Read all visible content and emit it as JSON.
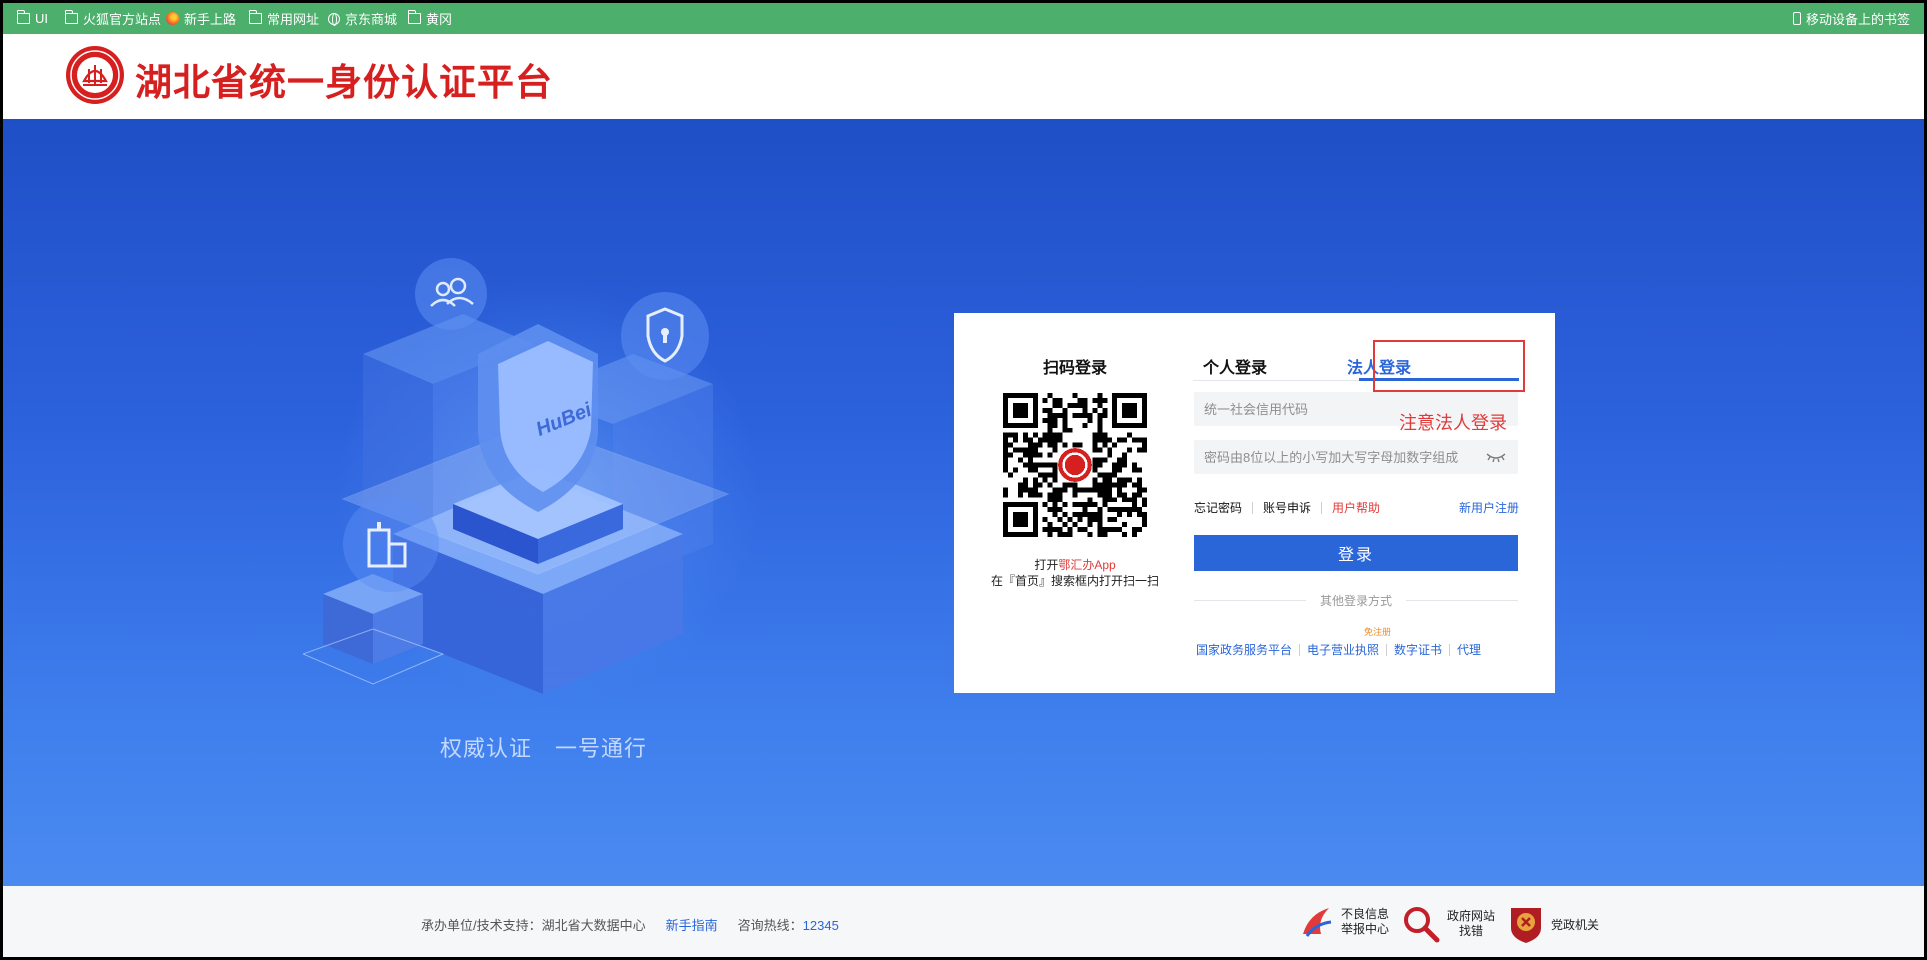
{
  "bookmarks": {
    "items": [
      {
        "label": "UI",
        "icon": "folder-icon"
      },
      {
        "label": "火狐官方站点",
        "icon": "folder-icon"
      },
      {
        "label": "新手上路",
        "icon": "firefox-icon"
      },
      {
        "label": "常用网址",
        "icon": "folder-icon"
      },
      {
        "label": "京东商城",
        "icon": "globe-icon"
      },
      {
        "label": "黄冈",
        "icon": "folder-icon"
      }
    ],
    "mobile": "移动设备上的书签"
  },
  "header": {
    "title": "湖北省统一身份认证平台"
  },
  "hero": {
    "slogan": "权威认证　一号通行"
  },
  "login": {
    "qr": {
      "title": "扫码登录",
      "hint_prefix": "打开",
      "hint_app": "鄂汇办App",
      "hint_line2": "在『首页』搜索框内打开扫一扫"
    },
    "tabs": {
      "personal": "个人登录",
      "legal": "法人登录"
    },
    "fields": {
      "credit_code_placeholder": "统一社会信用代码",
      "password_placeholder": "密码由8位以上的小写加大写字母加数字组成"
    },
    "annotation": "注意法人登录",
    "links": {
      "forgot": "忘记密码",
      "appeal": "账号申诉",
      "help": "用户帮助",
      "register": "新用户注册"
    },
    "submit": "登录",
    "other_label": "其他登录方式",
    "other_methods": {
      "national": "国家政务服务平台",
      "license": "电子营业执照",
      "license_badge": "免注册",
      "cert": "数字证书",
      "proxy": "代理"
    }
  },
  "footer": {
    "org": "承办单位/技术支持：湖北省大数据中心",
    "guide": "新手指南",
    "hotline_label": "咨询热线：",
    "hotline": "12345",
    "report_line1": "不良信息",
    "report_line2": "举报中心",
    "gov_line1": "政府网站",
    "gov_line2": "找错",
    "party": "党政机关"
  },
  "colors": {
    "accent": "#2a66d8",
    "brand_red": "#d61f1f",
    "bookmark_bar": "#4caf6c",
    "hero_top": "#1f4fc7",
    "hero_bottom": "#4a8af0"
  }
}
